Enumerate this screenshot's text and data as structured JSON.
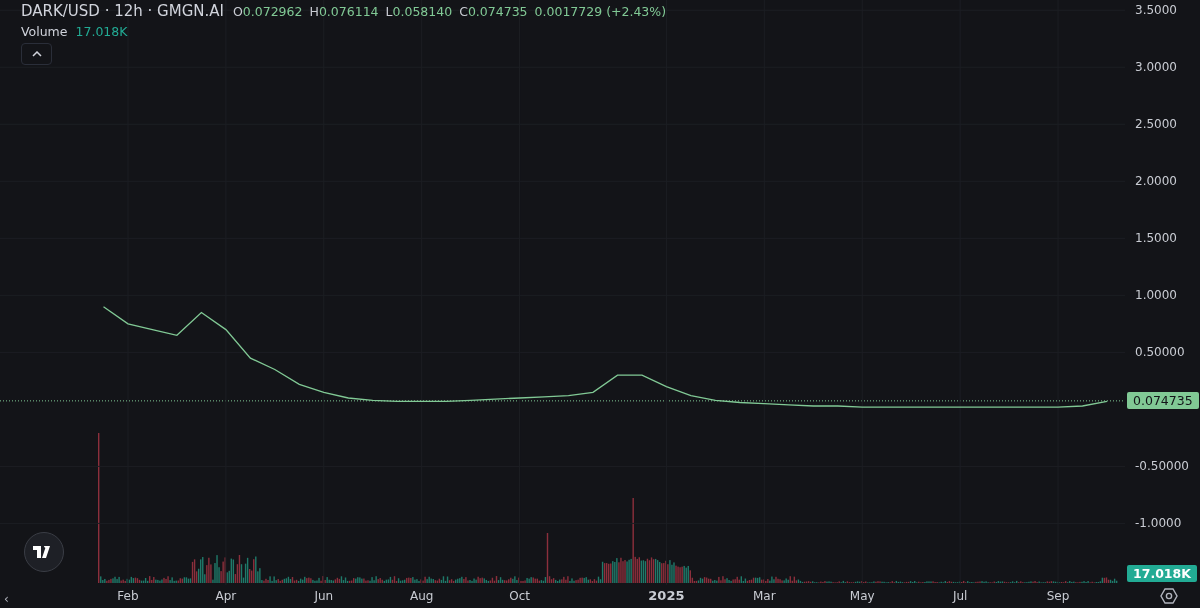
{
  "legend": {
    "symbol": "DARK/USD · 12h · GMGN.AI",
    "ohlc": [
      {
        "label": "O",
        "value": "0.072962"
      },
      {
        "label": "H",
        "value": "0.076114"
      },
      {
        "label": "L",
        "value": "0.058140"
      },
      {
        "label": "C",
        "value": "0.074735"
      }
    ],
    "change": "0.0017729 (+2.43%)",
    "volume_label": "Volume",
    "volume_value": "17.018K"
  },
  "price_chart": {
    "chart_data": {
      "type": "line",
      "categories": [
        null,
        "Feb",
        null,
        null,
        null,
        "Apr",
        null,
        null,
        null,
        "Jun",
        null,
        null,
        null,
        "Aug",
        null,
        null,
        null,
        "Oct",
        null,
        null,
        null,
        null,
        null,
        "2025",
        null,
        null,
        null,
        "Mar",
        null,
        null,
        null,
        "May",
        null,
        null,
        null,
        "Jul",
        null,
        null,
        null,
        "Sep",
        null,
        null
      ],
      "ylim": [
        -1.54,
        3.59
      ],
      "grid": true,
      "series": [
        {
          "color": "#81c995",
          "values": [
            0.9,
            0.75,
            0.7,
            0.65,
            0.85,
            0.7,
            0.45,
            0.35,
            0.22,
            0.15,
            0.1,
            0.08,
            0.07,
            0.07,
            0.07,
            0.08,
            0.09,
            0.1,
            0.11,
            0.12,
            0.15,
            0.3,
            0.3,
            0.2,
            0.12,
            0.08,
            0.06,
            0.05,
            0.04,
            0.03,
            0.03,
            0.02,
            0.02,
            0.02,
            0.02,
            0.02,
            0.02,
            0.02,
            0.02,
            0.02,
            0.03,
            0.07
          ]
        }
      ],
      "yticks": [
        {
          "value": 3.5,
          "label": "3.5000"
        },
        {
          "value": 3,
          "label": "3.0000"
        },
        {
          "value": 2.5,
          "label": "2.5000"
        },
        {
          "value": 2,
          "label": "2.0000"
        },
        {
          "value": 1.5,
          "label": "1.5000"
        },
        {
          "value": 1,
          "label": "1.0000"
        },
        {
          "value": 0.5,
          "label": "0.50000"
        },
        {
          "value": -0.5,
          "label": "-0.50000"
        },
        {
          "value": -1,
          "label": "-1.0000"
        }
      ]
    },
    "last_price": "0.074735",
    "last_volume": "17.018K"
  },
  "scroll_hint": "‹"
}
